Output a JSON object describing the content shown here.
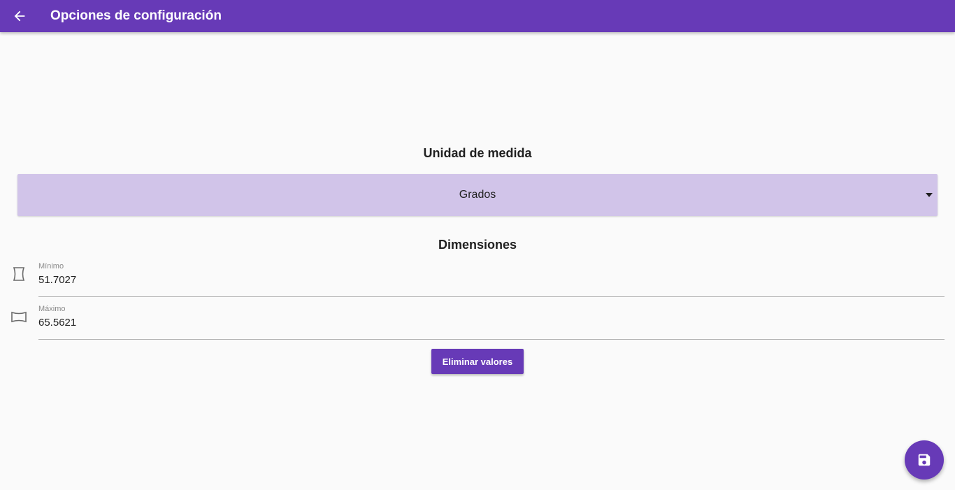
{
  "appbar": {
    "title": "Opciones de configuración",
    "back_icon": "arrow-back-icon",
    "color": "#673ab7"
  },
  "unit_section": {
    "title": "Unidad de medida",
    "select": {
      "selected": "Grados",
      "background": "#d1c4e9",
      "caret_icon": "caret-down-icon"
    }
  },
  "dimensions_section": {
    "title": "Dimensiones",
    "fields": [
      {
        "label": "Mínimo",
        "value": "51.7027",
        "icon": "hourglass-narrow-icon"
      },
      {
        "label": "Máximo",
        "value": "65.5621",
        "icon": "wide-frame-icon"
      }
    ]
  },
  "actions": {
    "clear_label": "Eliminar valores",
    "fab_icon": "save-icon"
  }
}
